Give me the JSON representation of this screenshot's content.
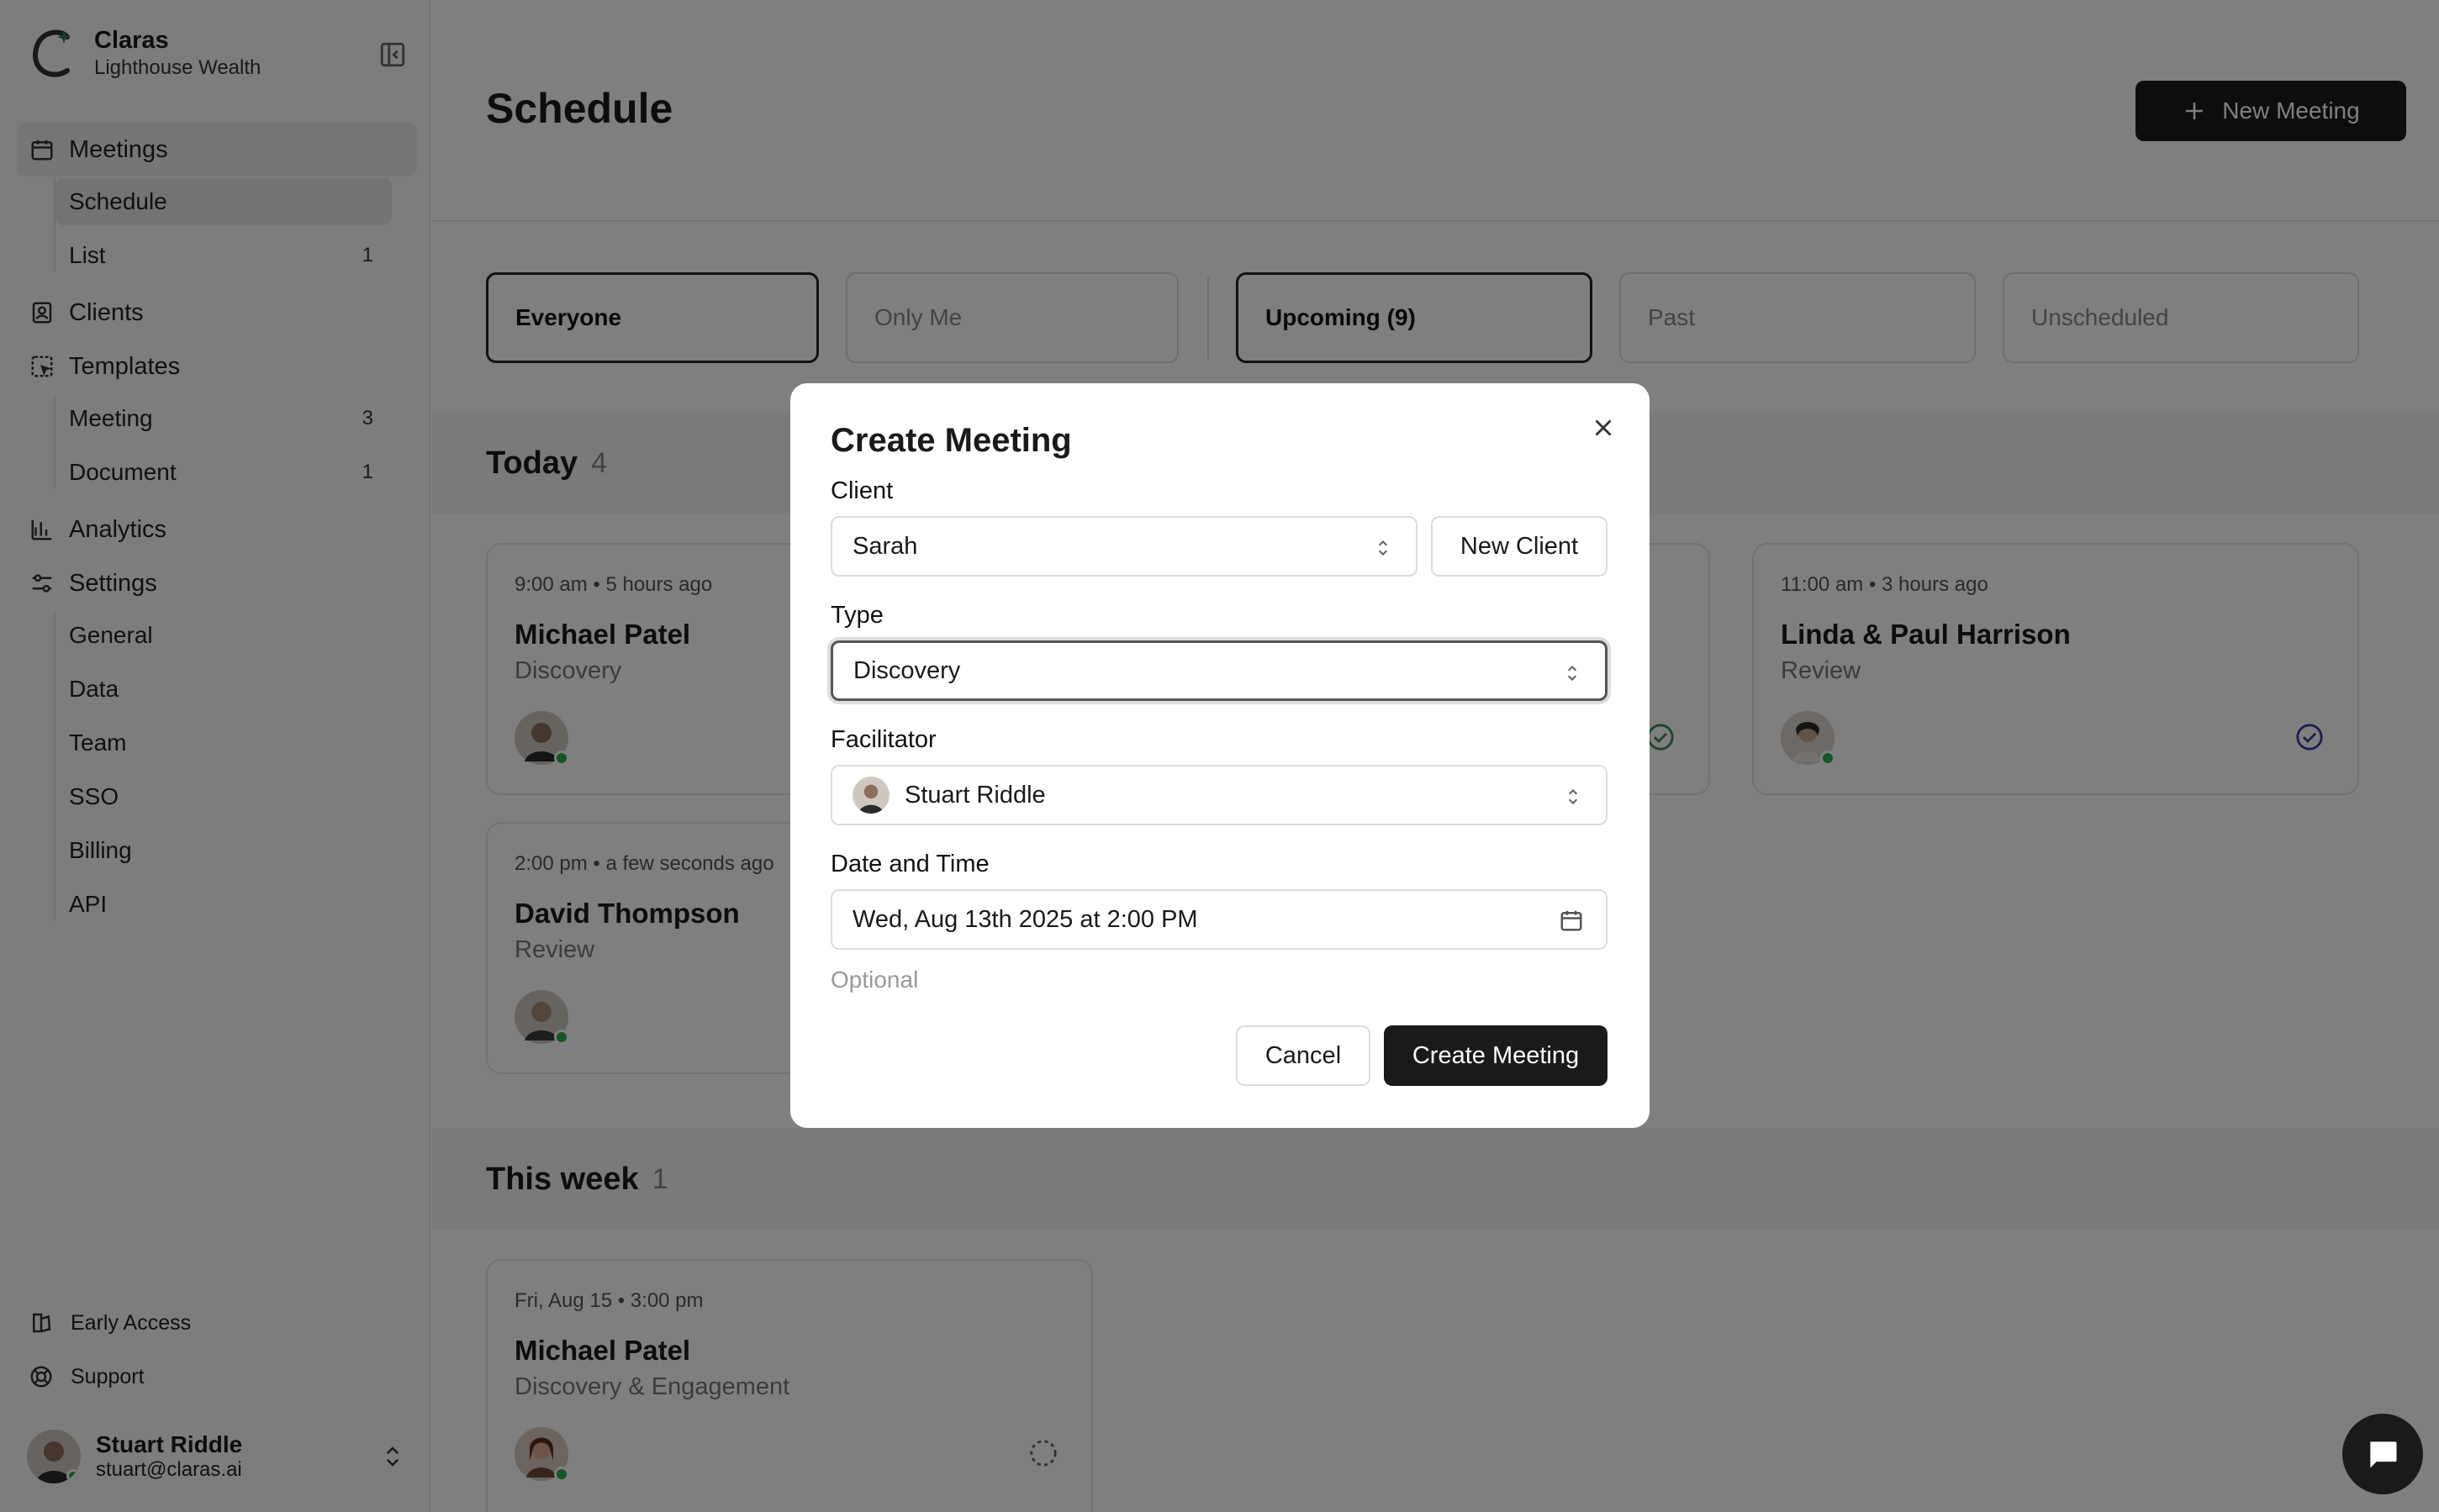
{
  "brand": {
    "name": "Claras",
    "org": "Lighthouse Wealth"
  },
  "sidebar": {
    "meetings": "Meetings",
    "schedule": "Schedule",
    "list": {
      "label": "List",
      "count": "1"
    },
    "clients": "Clients",
    "templates": "Templates",
    "meeting_tpl": {
      "label": "Meeting",
      "count": "3"
    },
    "document_tpl": {
      "label": "Document",
      "count": "1"
    },
    "analytics": "Analytics",
    "settings": "Settings",
    "settings_items": [
      "General",
      "Data",
      "Team",
      "SSO",
      "Billing",
      "API"
    ],
    "early_access": "Early Access",
    "support": "Support"
  },
  "user": {
    "name": "Stuart Riddle",
    "email": "stuart@claras.ai"
  },
  "header": {
    "title": "Schedule",
    "new_meeting": "New Meeting"
  },
  "filters": {
    "everyone": "Everyone",
    "only_me": "Only Me",
    "upcoming": "Upcoming (9)",
    "past": "Past",
    "unscheduled": "Unscheduled"
  },
  "sections": {
    "today": {
      "title": "Today",
      "count": "4"
    },
    "this_week": {
      "title": "This week",
      "count": "1"
    }
  },
  "cards": [
    {
      "time": "9:00 am • 5 hours ago",
      "name": "Michael Patel",
      "type": "Discovery"
    },
    {
      "time": "11:00 am • 3 hours ago",
      "name": "Linda & Paul Harrison",
      "type": "Review"
    },
    {
      "time": "2:00 pm • a few seconds ago",
      "name": "David Thompson",
      "type": "Review"
    },
    {
      "time": "Fri, Aug 15 • 3:00 pm",
      "name": "Michael Patel",
      "type": "Discovery & Engagement"
    }
  ],
  "modal": {
    "title": "Create Meeting",
    "client_label": "Client",
    "client_value": "Sarah",
    "new_client": "New Client",
    "type_label": "Type",
    "type_value": "Discovery",
    "facilitator_label": "Facilitator",
    "facilitator_value": "Stuart Riddle",
    "datetime_label": "Date and Time",
    "datetime_value": "Wed, Aug 13th 2025 at 2:00 PM",
    "optional": "Optional",
    "cancel": "Cancel",
    "create": "Create Meeting"
  },
  "colors": {
    "accent": "#1a1a1a",
    "online": "#2ea84d",
    "check_green": "#3a8a5a",
    "check_blue": "#3a3aa8"
  }
}
